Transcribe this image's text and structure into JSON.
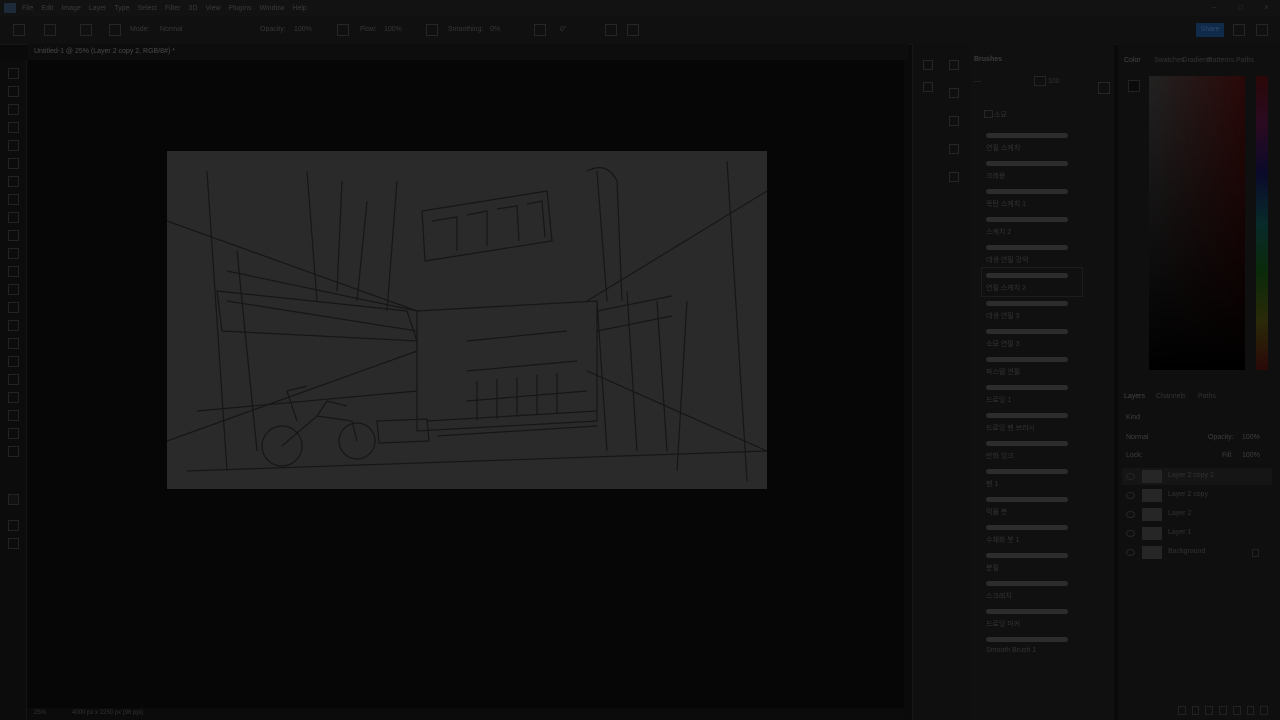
{
  "menubar": {
    "items": [
      "File",
      "Edit",
      "Image",
      "Layer",
      "Type",
      "Select",
      "Filter",
      "3D",
      "View",
      "Plugins",
      "Window",
      "Help"
    ]
  },
  "options": {
    "mode_label": "Mode:",
    "mode_value": "Normal",
    "opacity_label": "Opacity:",
    "opacity_value": "100%",
    "flow_label": "Flow:",
    "flow_value": "100%",
    "smoothing_label": "Smoothing:",
    "smoothing_value": "0%",
    "angle_value": "0°",
    "share_label": "Share"
  },
  "document": {
    "tab_title": "Untitled-1 @ 25% (Layer 2 copy 2, RGB/8#) *"
  },
  "status": {
    "zoom": "25%",
    "dimensions": "4000 px x 2250 px (96 ppi)"
  },
  "brushes_panel": {
    "title": "Brushes",
    "search_size": "100",
    "folder": "소묘",
    "items": [
      {
        "label": "연필 스케치"
      },
      {
        "label": "크레용"
      },
      {
        "label": "목탄 스케치 1"
      },
      {
        "label": "스케치 2"
      },
      {
        "label": "데생 연필 강약"
      },
      {
        "label": "연필 스케치 2"
      },
      {
        "label": "데생 연필 3"
      },
      {
        "label": "소묘 연필 3"
      },
      {
        "label": "파스텔 연필"
      },
      {
        "label": "드로잉 1"
      },
      {
        "label": "드로잉 펜 브러시"
      },
      {
        "label": "만화 잉크"
      },
      {
        "label": "펜 1"
      },
      {
        "label": "먹물 붓"
      },
      {
        "label": "수채화 붓 1"
      },
      {
        "label": "분필"
      },
      {
        "label": "스크래치"
      },
      {
        "label": "드로잉 마커"
      },
      {
        "label": "Smooth Brush 1"
      }
    ]
  },
  "color_panel": {
    "tabs": [
      "Color",
      "Swatches",
      "Gradients",
      "Patterns",
      "Paths"
    ]
  },
  "layers_panel": {
    "tabs": [
      "Layers",
      "Channels",
      "Paths"
    ],
    "kind_label": "Kind",
    "blend_mode": "Normal",
    "opacity_label": "Opacity:",
    "opacity_value": "100%",
    "lock_label": "Lock:",
    "fill_label": "Fill:",
    "fill_value": "100%",
    "layers": [
      {
        "name": "Layer 2 copy 2",
        "selected": true
      },
      {
        "name": "Layer 2 copy",
        "selected": false
      },
      {
        "name": "Layer 2",
        "selected": false
      },
      {
        "name": "Layer 1",
        "selected": false
      },
      {
        "name": "Background",
        "selected": false
      }
    ]
  }
}
